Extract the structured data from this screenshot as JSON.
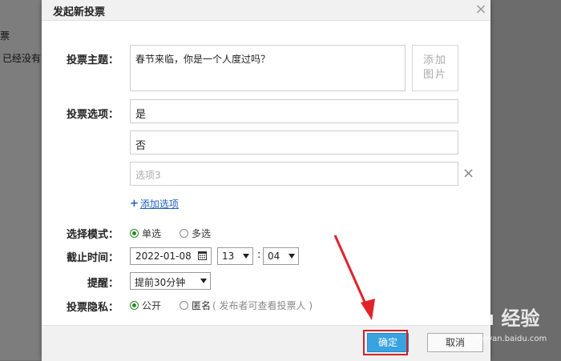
{
  "background": {
    "left_text_1": "票",
    "left_text_2": "已经没有"
  },
  "dialog": {
    "title": "发起新投票",
    "close_glyph": "×"
  },
  "form": {
    "topic_label": "投票主题：",
    "topic_value": "春节来临，你是一个人度过吗？",
    "add_image_label": "添加图片",
    "options_label": "投票选项：",
    "options": [
      {
        "value": "是",
        "placeholder": ""
      },
      {
        "value": "否",
        "placeholder": ""
      },
      {
        "value": "",
        "placeholder": "选项3"
      }
    ],
    "delete_option_glyph": "×",
    "add_option_plus": "+",
    "add_option_label": "添加选项",
    "mode_label": "选择模式：",
    "mode_options": [
      "单选",
      "多选"
    ],
    "mode_selected": "单选",
    "deadline_label": "截止时间：",
    "deadline_date": "2022-01-08",
    "deadline_hour": "13",
    "deadline_colon": ":",
    "deadline_minute": "04",
    "reminder_label": "提醒：",
    "reminder_value": "提前30分钟",
    "privacy_label": "投票隐私：",
    "privacy_options": [
      "公开",
      "匿名"
    ],
    "privacy_selected": "公开",
    "privacy_note": "( 发布者可查看投票人 )"
  },
  "footer": {
    "ok_label": "确定",
    "cancel_label": "取消"
  },
  "watermark": {
    "brand": "Baidu 经验",
    "sub": "jingyan.baidu.com"
  },
  "colors": {
    "ok_button": "#38a3e0",
    "highlight_box": "#d0212b",
    "link": "#1f5fbf",
    "radio_selected": "#2a8a2a"
  }
}
